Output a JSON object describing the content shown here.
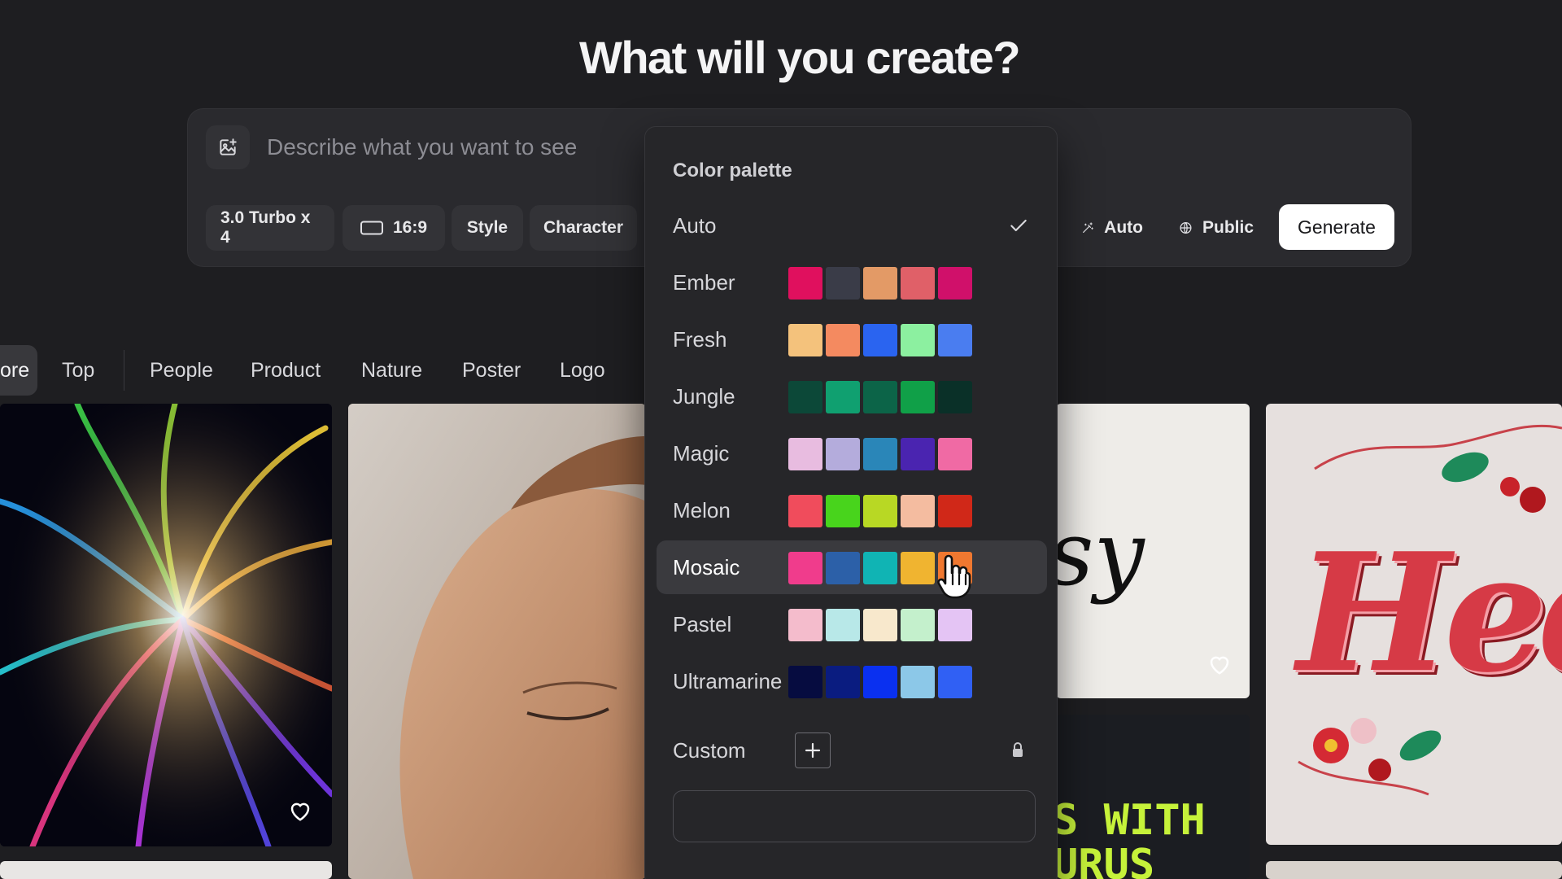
{
  "header": {
    "title": "What will you create?"
  },
  "prompt": {
    "placeholder": "Describe what you want to see",
    "model_chip": "3.0 Turbo x 4",
    "aspect_chip": "16:9",
    "style_chip": "Style",
    "character_chip": "Character",
    "magic_prompt_chip": "Auto",
    "visibility_chip": "Public",
    "generate_label": "Generate"
  },
  "tabs": {
    "items": [
      {
        "label": "ore"
      },
      {
        "label": "Top"
      },
      {
        "label": "People"
      },
      {
        "label": "Product"
      },
      {
        "label": "Nature"
      },
      {
        "label": "Poster"
      },
      {
        "label": "Logo"
      }
    ]
  },
  "gallery": {
    "text_fragment_1": "sy",
    "text_fragment_2": "Hed",
    "text_fragment_3": "S WITH",
    "text_fragment_4": "URUS"
  },
  "palette_menu": {
    "heading": "Color palette",
    "auto_label": "Auto",
    "custom_label": "Custom",
    "palettes": [
      {
        "label": "Ember",
        "colors": [
          "#e0105e",
          "#3a3c48",
          "#e39a66",
          "#e06068",
          "#d0106a"
        ]
      },
      {
        "label": "Fresh",
        "colors": [
          "#f4c27c",
          "#f48a60",
          "#2a64f0",
          "#8cf0a0",
          "#4a7df0"
        ]
      },
      {
        "label": "Jungle",
        "colors": [
          "#0c4838",
          "#10a070",
          "#0c6448",
          "#10a048",
          "#0a3028"
        ]
      },
      {
        "label": "Magic",
        "colors": [
          "#e8bce0",
          "#b4acdc",
          "#2a86b8",
          "#4a24b0",
          "#f06aa4"
        ]
      },
      {
        "label": "Melon",
        "colors": [
          "#f04c5c",
          "#48d41c",
          "#b8d824",
          "#f4bca0",
          "#d02818"
        ]
      },
      {
        "label": "Mosaic",
        "colors": [
          "#f03c8c",
          "#2c60a8",
          "#10b4b4",
          "#f0b430",
          "#f07830"
        ]
      },
      {
        "label": "Pastel",
        "colors": [
          "#f4bccc",
          "#b8e8e8",
          "#f8e8cc",
          "#c4f0cc",
          "#e4c4f4"
        ]
      },
      {
        "label": "Ultramarine",
        "colors": [
          "#060c40",
          "#0a1c80",
          "#0a30f0",
          "#8cc8e8",
          "#3060f4"
        ]
      }
    ]
  }
}
